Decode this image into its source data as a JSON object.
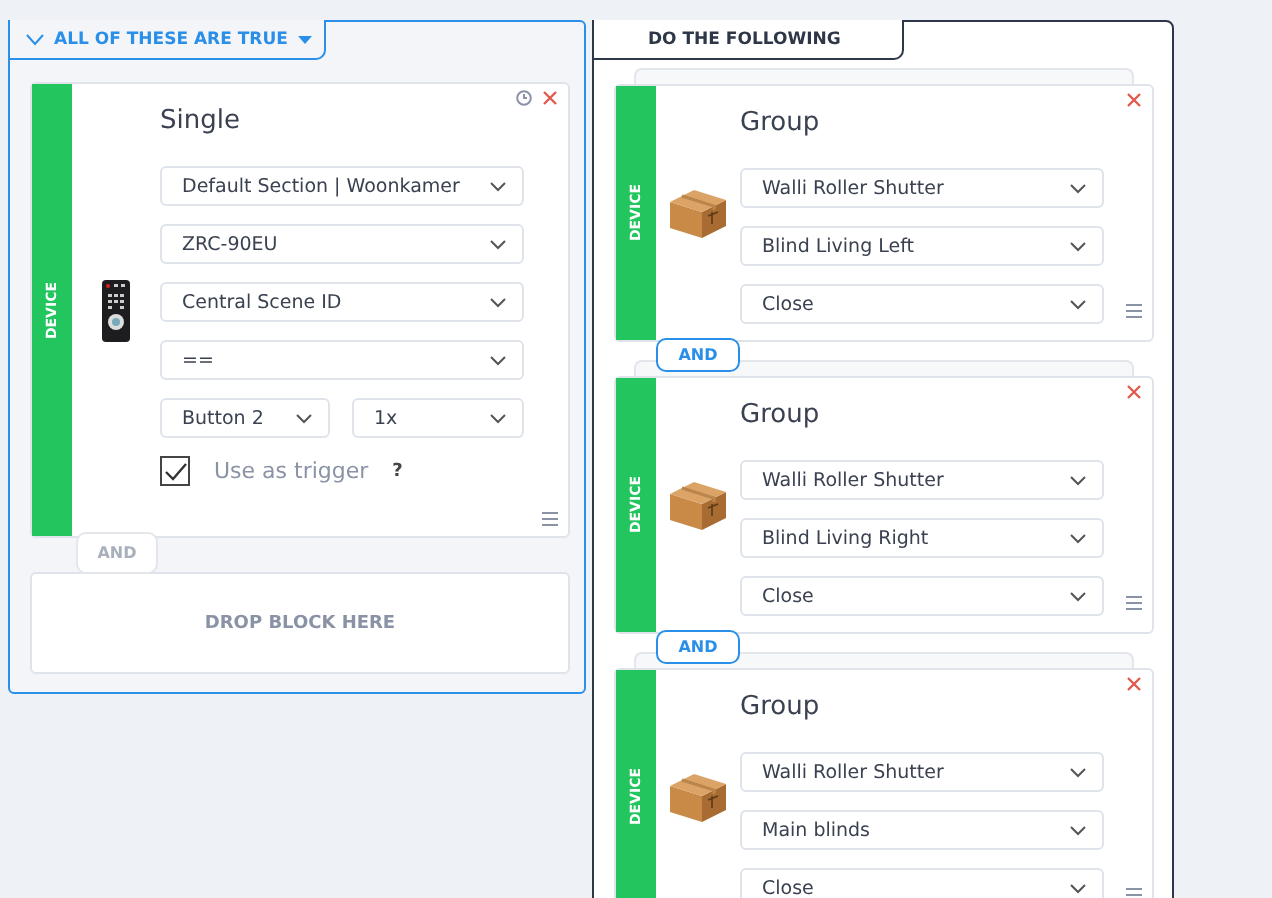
{
  "conditions": {
    "header": {
      "label": "ALL OF THESE ARE TRUE"
    },
    "blocks": [
      {
        "kind": "device",
        "category": "DEVICE",
        "title": "Single",
        "selects": [
          "Default Section | Woonkamer",
          "ZRC-90EU",
          "Central Scene ID",
          "=="
        ],
        "pair": [
          "Button 2",
          "1x"
        ],
        "trigger": {
          "label": "Use as trigger",
          "checked": true,
          "help": "?"
        }
      }
    ],
    "connector": {
      "label": "AND",
      "active": false
    },
    "drop_zone": "DROP BLOCK HERE"
  },
  "actions": {
    "header": {
      "label": "DO THE FOLLOWING"
    },
    "blocks": [
      {
        "kind": "group",
        "category": "DEVICE",
        "title": "Group",
        "selects": [
          "Walli Roller Shutter",
          "Blind Living Left",
          "Close"
        ]
      },
      {
        "kind": "group",
        "category": "DEVICE",
        "title": "Group",
        "selects": [
          "Walli Roller Shutter",
          "Blind Living Right",
          "Close"
        ]
      },
      {
        "kind": "group",
        "category": "DEVICE",
        "title": "Group",
        "selects": [
          "Walli Roller Shutter",
          "Main blinds",
          "Close"
        ]
      }
    ],
    "connectors": [
      {
        "label": "AND",
        "active": true
      },
      {
        "label": "AND",
        "active": true
      }
    ]
  }
}
